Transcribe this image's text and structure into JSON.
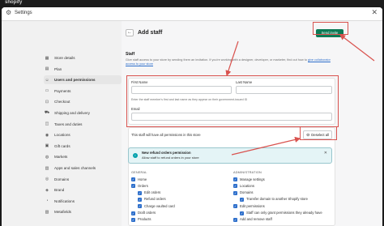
{
  "app": {
    "logo": "shopify"
  },
  "window": {
    "title": "Settings",
    "close": "✕"
  },
  "sidebar": {
    "items": [
      {
        "label": "Store details",
        "icon": "store-icon",
        "glyph": "▦",
        "active": false
      },
      {
        "label": "Plan",
        "icon": "plan-icon",
        "glyph": "▤",
        "active": false
      },
      {
        "label": "Users and permissions",
        "icon": "users-icon",
        "glyph": "☺",
        "active": true
      },
      {
        "label": "Payments",
        "icon": "payments-icon",
        "glyph": "▭",
        "active": false
      },
      {
        "label": "Checkout",
        "icon": "checkout-icon",
        "glyph": "⊡",
        "active": false
      },
      {
        "label": "Shipping and delivery",
        "icon": "truck-icon",
        "glyph": "⛟",
        "active": false
      },
      {
        "label": "Taxes and duties",
        "icon": "taxes-icon",
        "glyph": "◫",
        "active": false
      },
      {
        "label": "Locations",
        "icon": "location-icon",
        "glyph": "◉",
        "active": false
      },
      {
        "label": "Gift cards",
        "icon": "gift-icon",
        "glyph": "▣",
        "active": false
      },
      {
        "label": "Markets",
        "icon": "globe-icon",
        "glyph": "◍",
        "active": false
      },
      {
        "label": "Apps and sales channels",
        "icon": "apps-icon",
        "glyph": "▥",
        "active": false
      },
      {
        "label": "Domains",
        "icon": "domains-icon",
        "glyph": "◎",
        "active": false
      },
      {
        "label": "Brand",
        "icon": "brand-icon",
        "glyph": "◈",
        "active": false
      },
      {
        "label": "Notifications",
        "icon": "bell-icon",
        "glyph": "◔",
        "active": false
      },
      {
        "label": "Metafields",
        "icon": "metafields-icon",
        "glyph": "▧",
        "active": false
      }
    ]
  },
  "header": {
    "back": "←",
    "title": "Add staff",
    "send_invite": "Send invite"
  },
  "staff_section": {
    "title": "Staff",
    "desc": "Give staff access to your store by sending them an invitation. If you're working with a designer, developer, or marketer, find out how to",
    "link": "give collaborator access to your store"
  },
  "form": {
    "first_name_label": "First Name",
    "last_name_label": "Last Name",
    "name_help": "Enter the staff member's first and last name as they appear on their government-issued ID",
    "email_label": "Email"
  },
  "permissions": {
    "summary": "This staff will have all permissions in this store",
    "deselect_label": "Deselect all",
    "banner_title": "New refund orders permission",
    "banner_desc": "Allow staff to refund orders in your store",
    "general_heading": "GENERAL",
    "admin_heading": "ADMINISTRATION",
    "general": [
      {
        "label": "Home",
        "indent": false
      },
      {
        "label": "Orders",
        "indent": false
      },
      {
        "label": "Edit orders",
        "indent": true
      },
      {
        "label": "Refund orders",
        "indent": true
      },
      {
        "label": "Charge vaulted card",
        "indent": true
      },
      {
        "label": "Draft orders",
        "indent": false
      },
      {
        "label": "Products",
        "indent": false
      }
    ],
    "admin": [
      {
        "label": "Manage settings",
        "indent": false
      },
      {
        "label": "Locations",
        "indent": false
      },
      {
        "label": "Domains",
        "indent": false
      },
      {
        "label": "Transfer domain to another Shopify store",
        "indent": true
      },
      {
        "label": "Edit permissions",
        "indent": false
      },
      {
        "label": "Staff can only grant permissions they already have",
        "indent": true
      },
      {
        "label": "Add and remove staff",
        "indent": false
      }
    ]
  },
  "colors": {
    "accent": "#0d7a55",
    "annotation": "#d9534f",
    "checkbox": "#2c6ecb"
  }
}
